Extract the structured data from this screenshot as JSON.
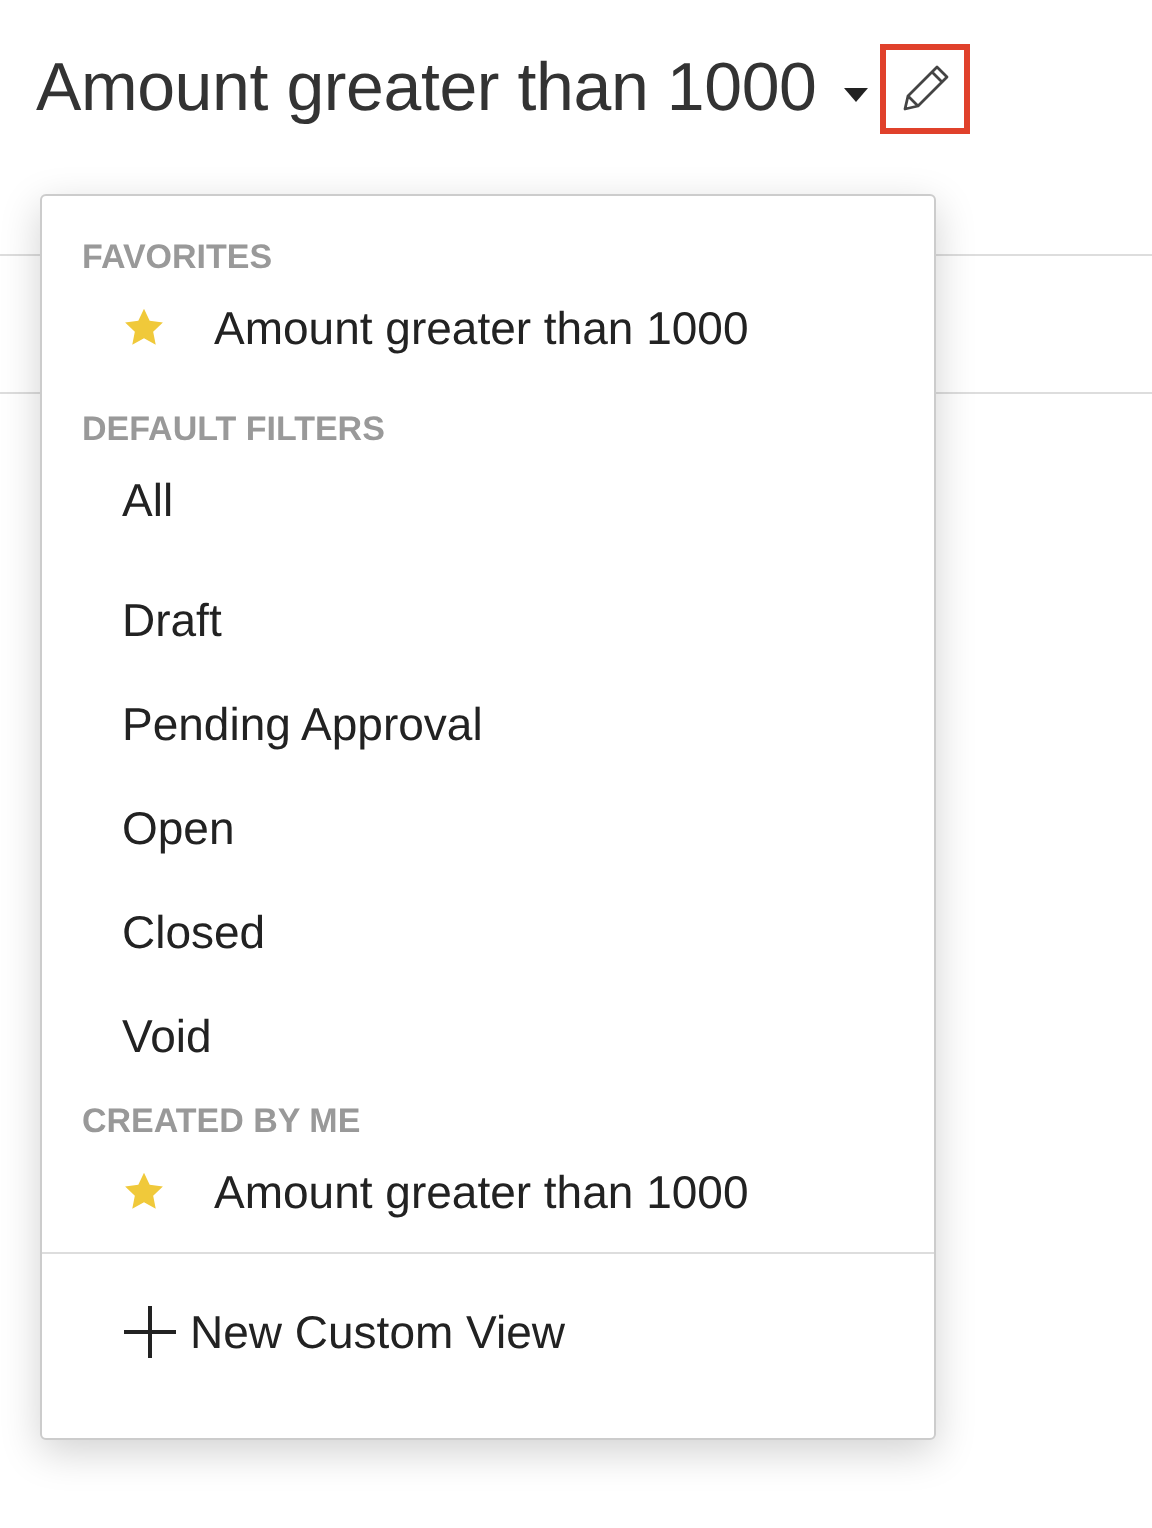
{
  "view_selector": {
    "title": "Amount greater than 1000",
    "edit_button": {
      "highlighted": true
    }
  },
  "menu": {
    "sections": [
      {
        "heading": "FAVORITES",
        "items": [
          {
            "label": "Amount greater than 1000",
            "starred": true
          }
        ]
      },
      {
        "heading": "DEFAULT FILTERS",
        "items": [
          {
            "label": "All",
            "starred": false
          },
          {
            "label": "Draft",
            "starred": false
          },
          {
            "label": "Pending Approval",
            "starred": false
          },
          {
            "label": "Open",
            "starred": false
          },
          {
            "label": "Closed",
            "starred": false
          },
          {
            "label": "Void",
            "starred": false
          }
        ]
      },
      {
        "heading": "CREATED BY ME",
        "items": [
          {
            "label": "Amount greater than 1000",
            "starred": true
          }
        ]
      }
    ],
    "footer_action": {
      "label": "New Custom View"
    }
  }
}
